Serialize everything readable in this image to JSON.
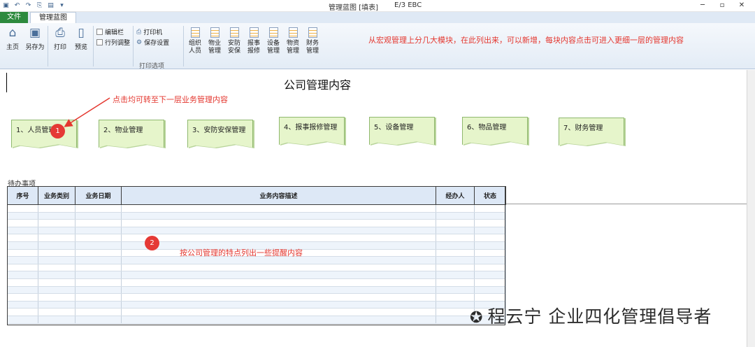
{
  "titlebar": {
    "doc_title": "管理蓝图 [填表]",
    "doc_code": "E/3 EBC",
    "qat_icons": [
      "app-icon",
      "undo-icon",
      "redo-icon",
      "copy-icon",
      "paste-icon",
      "customize-icon"
    ]
  },
  "tabs": {
    "file": "文件",
    "main": "管理蓝图"
  },
  "ribbon": {
    "home": "主页",
    "save_as": "另存为",
    "print": "打印",
    "preview": "预览",
    "edit_bar": "编辑栏",
    "row_col_adjust": "行列调整",
    "printer": "打印机",
    "save_settings": "保存设置",
    "print_options": "打印选项",
    "modules": [
      {
        "l1": "组织",
        "l2": "人员"
      },
      {
        "l1": "物业",
        "l2": "管理"
      },
      {
        "l1": "安防",
        "l2": "安保"
      },
      {
        "l1": "报事",
        "l2": "报修"
      },
      {
        "l1": "设备",
        "l2": "管理"
      },
      {
        "l1": "物资",
        "l2": "管理"
      },
      {
        "l1": "财务",
        "l2": "管理"
      }
    ],
    "note": "从宏观管理上分几大模块，在此列出来，可以新增，每块内容点击可进入更细一层的管理内容"
  },
  "sheet": {
    "title": "公司管理内容",
    "annot1": "点击均可转至下一层业务管理内容",
    "cards": [
      "1、人员管理",
      "2、物业管理",
      "3、安防安保管理",
      "4、报事报修管理",
      "5、设备管理",
      "6、物品管理",
      "7、财务管理"
    ],
    "badge1": "1",
    "badge2": "2",
    "todo_label": "待办事项",
    "columns": [
      "序号",
      "业务类别",
      "业务日期",
      "业务内容描述",
      "经办人",
      "状态"
    ],
    "annot2": "按公司管理的特点列出一些提醒内容"
  },
  "watermark": "程云宁 企业四化管理倡导者",
  "colors": {
    "annotation": "#e4372f",
    "card": "#e6f5cb",
    "header": "#dde8f6",
    "file_tab": "#2d8a3e"
  }
}
